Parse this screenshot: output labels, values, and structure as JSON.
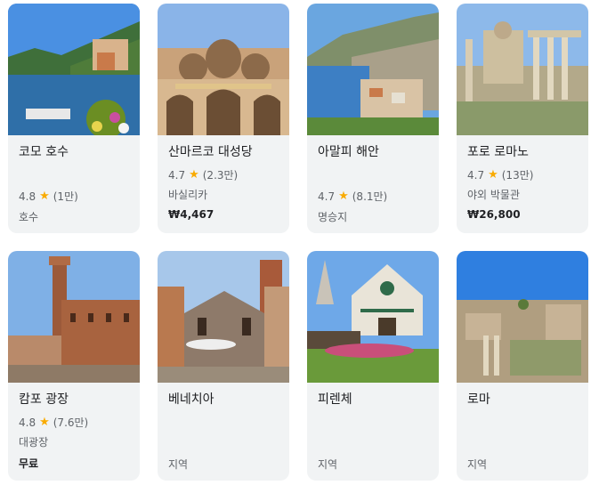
{
  "cards": [
    {
      "name": "코모 호수",
      "rating": "4.8",
      "reviews": "(1만)",
      "category": "호수",
      "price": ""
    },
    {
      "name": "산마르코 대성당",
      "rating": "4.7",
      "reviews": "(2.3만)",
      "category": "바실리카",
      "price": "₩4,467"
    },
    {
      "name": "아말피 해안",
      "rating": "4.7",
      "reviews": "(8.1만)",
      "category": "명승지",
      "price": ""
    },
    {
      "name": "포로 로마노",
      "rating": "4.7",
      "reviews": "(13만)",
      "category": "야외 박물관",
      "price": "₩26,800"
    },
    {
      "name": "캄포 광장",
      "rating": "4.8",
      "reviews": "(7.6만)",
      "category": "대광장",
      "price": "무료"
    },
    {
      "name": "베네치아",
      "category": "지역"
    },
    {
      "name": "피렌체",
      "category": "지역"
    },
    {
      "name": "로마",
      "category": "지역"
    }
  ],
  "icons": {
    "rating_star": "star-icon"
  },
  "colors": {
    "card_bg": "#f1f3f4",
    "star": "#f9ab00",
    "muted_text": "#5f6368"
  }
}
